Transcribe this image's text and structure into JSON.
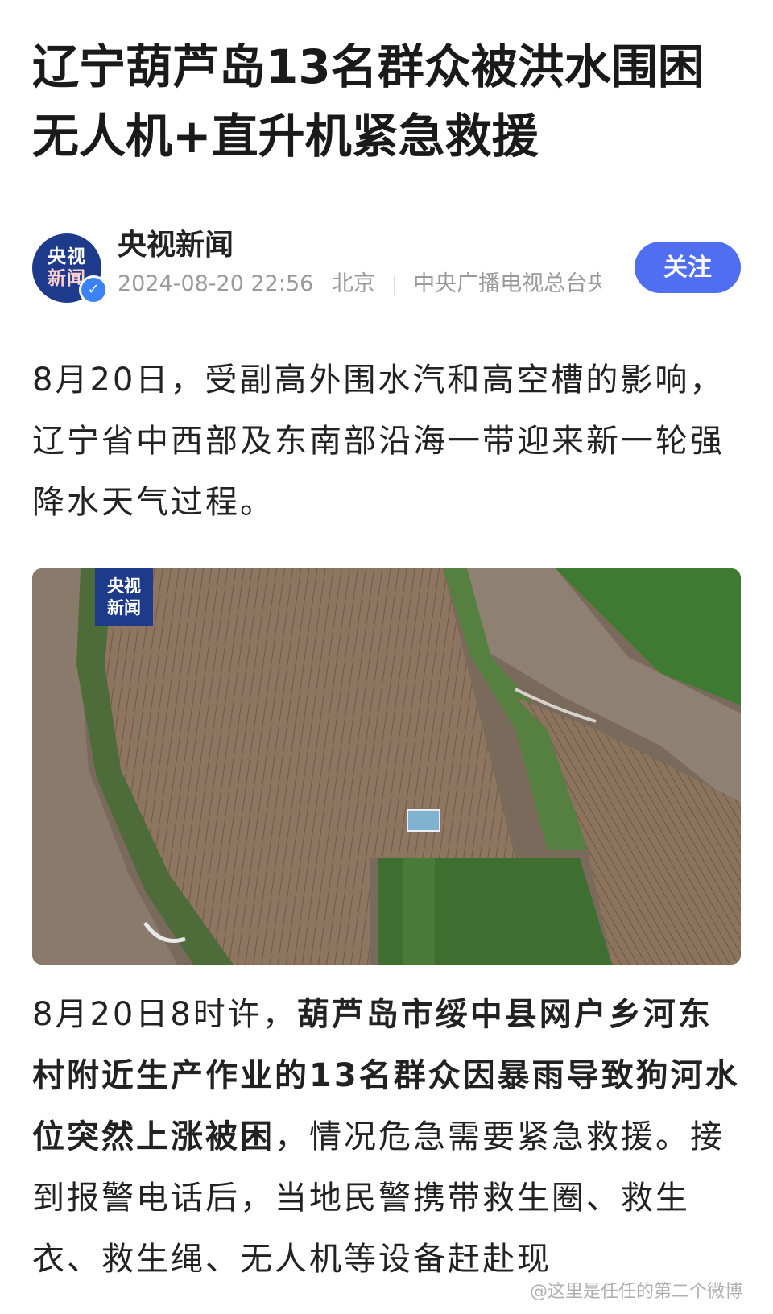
{
  "article": {
    "title_line1": "辽宁葫芦岛13名群众被洪水围困",
    "title_line2": "无人机+直升机紧急救援"
  },
  "author": {
    "avatar_text_line1": "央视",
    "avatar_text_line2": "新闻",
    "name": "央视新闻",
    "datetime": "2024-08-20 22:56",
    "location": "北京",
    "source": "中央广播电视总台央...",
    "follow_label": "关注"
  },
  "body": {
    "paragraph1": "8月20日，受副高外围水汽和高空槽的影响，辽宁省中西部及东南部沿海一带迎来新一轮强降水天气过程。",
    "paragraph2_lead": "8月20日8时许，",
    "paragraph2_bold": "葫芦岛市绥中县网户乡河东村附近生产作业的13名群众因暴雨导致狗河水位突然上涨被困",
    "paragraph2_rest": "，情况危急需要紧急救援。接到报警电话后，当地民警携带救生圈、救生衣、救生绳、无人机等设备赶赴现"
  },
  "image": {
    "logo_line1": "央视",
    "logo_line2": "新闻"
  },
  "watermark": "@这里是任任的第二个微博",
  "colors": {
    "accent": "#4f6ef2",
    "brand_blue": "#1e3a8a",
    "meta_gray": "#9a9a9a"
  }
}
